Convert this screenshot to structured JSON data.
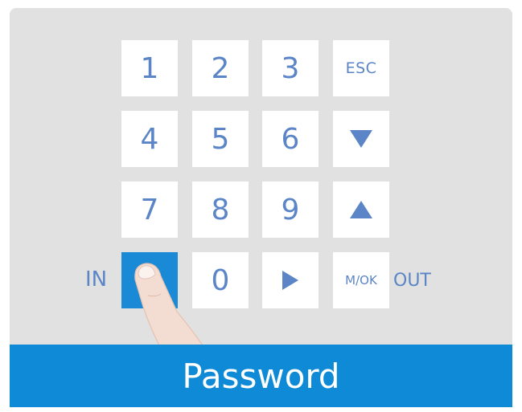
{
  "keypad": {
    "keys": [
      {
        "label": "1"
      },
      {
        "label": "2"
      },
      {
        "label": "3"
      },
      {
        "label": "ESC"
      },
      {
        "label": "4"
      },
      {
        "label": "5"
      },
      {
        "label": "6"
      },
      {
        "icon": "arrow-down-icon"
      },
      {
        "label": "7"
      },
      {
        "label": "8"
      },
      {
        "label": "9"
      },
      {
        "icon": "arrow-up-icon"
      },
      {
        "icon": "pressed-key",
        "state": "pressed"
      },
      {
        "label": "0"
      },
      {
        "icon": "arrow-right-icon"
      },
      {
        "label": "M/OK"
      }
    ],
    "in_label": "IN",
    "out_label": "OUT"
  },
  "footer": {
    "title": "Password"
  },
  "colors": {
    "panel": "#e1e1e1",
    "key": "#ffffff",
    "key_text": "#5b85c6",
    "accent": "#0f8ad6"
  }
}
